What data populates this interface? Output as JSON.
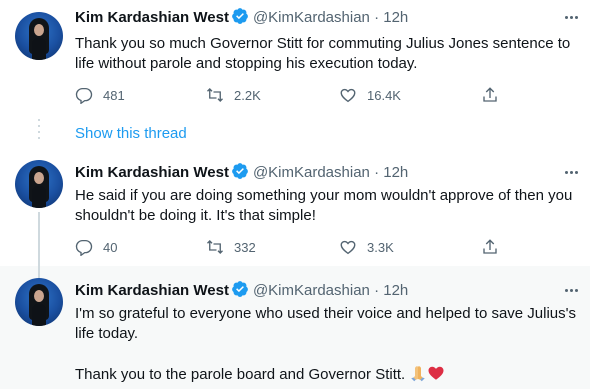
{
  "tweets": [
    {
      "name": "Kim Kardashian West",
      "handle": "@KimKardashian",
      "time": "· 12h",
      "text": "Thank you so much Governor Stitt for commuting Julius Jones sentence to life without parole and stopping his execution today.",
      "replies": "481",
      "retweets": "2.2K",
      "likes": "16.4K"
    },
    {
      "name": "Kim Kardashian West",
      "handle": "@KimKardashian",
      "time": "· 12h",
      "text": "He said if you are doing something your mom wouldn't approve of then you shouldn't be doing it. It's that simple!",
      "replies": "40",
      "retweets": "332",
      "likes": "3.3K"
    },
    {
      "name": "Kim Kardashian West",
      "handle": "@KimKardashian",
      "time": "· 12h",
      "text": "I'm so grateful to everyone who used their voice and helped to save Julius's life today.",
      "text2": "Thank you to the parole board and Governor Stitt."
    }
  ],
  "show_thread": "Show this thread",
  "colors": {
    "accent": "#1d9bf0",
    "secondary": "#536471",
    "like_heart": "#e0245e",
    "hover_bg": "#f7f9f9"
  },
  "icons": [
    "verified-badge-icon",
    "more-icon",
    "reply-icon",
    "retweet-icon",
    "like-icon",
    "share-icon",
    "folded-hands-emoji-icon",
    "red-heart-emoji-icon"
  ]
}
